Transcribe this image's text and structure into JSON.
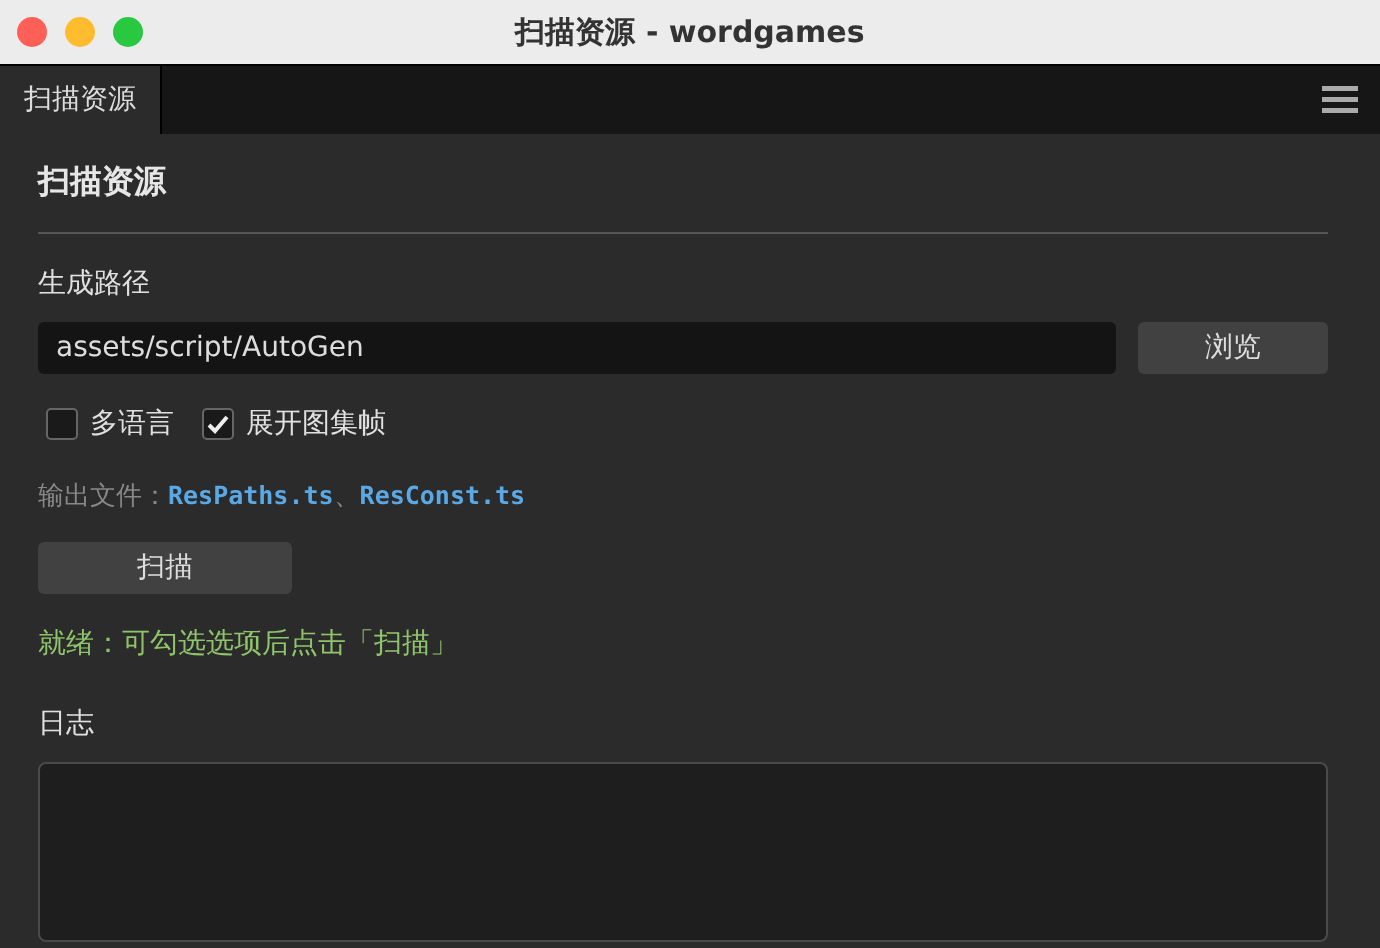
{
  "window": {
    "title": "扫描资源 - wordgames"
  },
  "tabs": [
    {
      "label": "扫描资源",
      "selected": true
    }
  ],
  "panel": {
    "heading": "扫描资源",
    "path_label": "生成路径",
    "path_value": "assets/script/AutoGen",
    "browse_button": "浏览",
    "options": [
      {
        "label": "多语言",
        "checked": false
      },
      {
        "label": "展开图集帧",
        "checked": true
      }
    ],
    "output": {
      "label": "输出文件：",
      "files": [
        "ResPaths.ts",
        "ResConst.ts"
      ],
      "separator": "、"
    },
    "scan_button": "扫描",
    "status": "就绪：可勾选选项后点击「扫描」",
    "log_label": "日志"
  }
}
